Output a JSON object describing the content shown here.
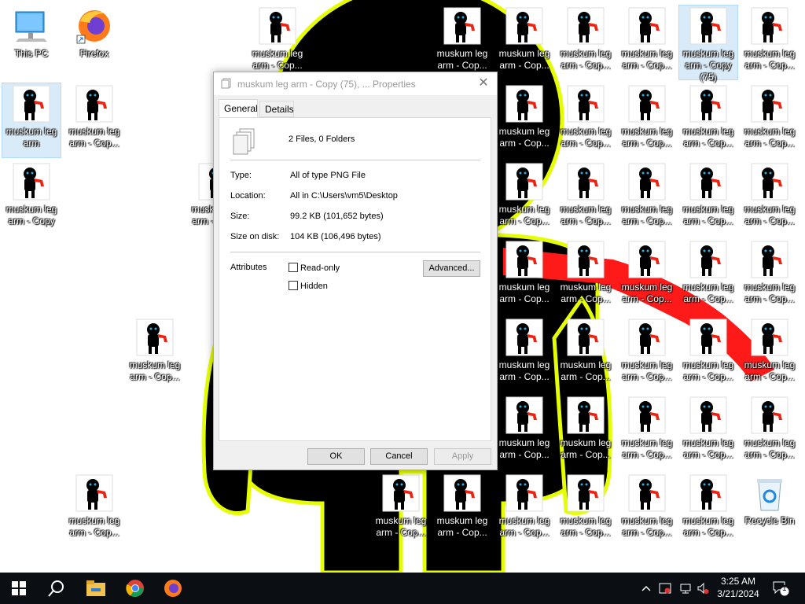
{
  "desktop": {
    "icons": [
      {
        "label": "This PC"
      },
      {
        "label": "Firefox"
      },
      {
        "label": "muskum leg arm"
      },
      {
        "label": "muskum leg arm - Cop..."
      },
      {
        "label": "muskum leg arm - Copy"
      },
      {
        "label": "muskum leg arm - Cop..."
      },
      {
        "label": "muskum leg arm - Cop..."
      },
      {
        "label": "muskum leg arm - Cop..."
      },
      {
        "label": "muskum leg arm - Cop..."
      },
      {
        "label": "muskum leg arm - Cop..."
      },
      {
        "label": "muskum leg arm - Cop..."
      },
      {
        "label": "muskum leg arm - Cop..."
      },
      {
        "label": "muskum leg arm - Copy (75)"
      },
      {
        "label": "muskum leg arm - Cop..."
      },
      {
        "label": "Recycle Bin"
      }
    ],
    "grid_label": "muskum leg arm - Cop..."
  },
  "dialog": {
    "title": "muskum leg arm - Copy (75), ... Properties",
    "close_glyph": "✕",
    "tabs": [
      "General",
      "Details"
    ],
    "summary": "2 Files, 0 Folders",
    "fields": [
      {
        "label": "Type:",
        "value": "All of type PNG File"
      },
      {
        "label": "Location:",
        "value": "All in C:\\Users\\vm5\\Desktop"
      },
      {
        "label": "Size:",
        "value": "99.2 KB (101,652 bytes)"
      },
      {
        "label": "Size on disk:",
        "value": "104 KB (106,496 bytes)"
      }
    ],
    "attributes_label": "Attributes",
    "readonly_label": "Read-only",
    "hidden_label": "Hidden",
    "advanced_label": "Advanced...",
    "ok_label": "OK",
    "cancel_label": "Cancel",
    "apply_label": "Apply"
  },
  "taskbar": {
    "time": "3:25 AM",
    "date": "3/21/2024",
    "notification_count": "1",
    "icons": [
      "windows-start-icon",
      "search-icon",
      "file-explorer-icon",
      "chrome-icon",
      "firefox-icon"
    ]
  },
  "colors": {
    "taskbar": "#0b0f14",
    "wallpaper_outline": "#e6ff00",
    "figure": "#000000",
    "scarf": "#ff1a1a"
  }
}
